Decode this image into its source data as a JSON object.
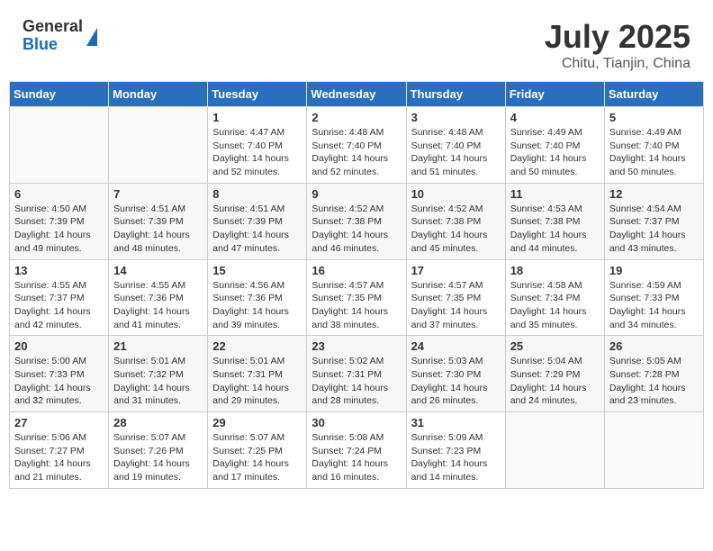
{
  "header": {
    "logo_general": "General",
    "logo_blue": "Blue",
    "main_title": "July 2025",
    "subtitle": "Chitu, Tianjin, China"
  },
  "weekdays": [
    "Sunday",
    "Monday",
    "Tuesday",
    "Wednesday",
    "Thursday",
    "Friday",
    "Saturday"
  ],
  "weeks": [
    [
      {
        "day": "",
        "info": ""
      },
      {
        "day": "",
        "info": ""
      },
      {
        "day": "1",
        "info": "Sunrise: 4:47 AM\nSunset: 7:40 PM\nDaylight: 14 hours\nand 52 minutes."
      },
      {
        "day": "2",
        "info": "Sunrise: 4:48 AM\nSunset: 7:40 PM\nDaylight: 14 hours\nand 52 minutes."
      },
      {
        "day": "3",
        "info": "Sunrise: 4:48 AM\nSunset: 7:40 PM\nDaylight: 14 hours\nand 51 minutes."
      },
      {
        "day": "4",
        "info": "Sunrise: 4:49 AM\nSunset: 7:40 PM\nDaylight: 14 hours\nand 50 minutes."
      },
      {
        "day": "5",
        "info": "Sunrise: 4:49 AM\nSunset: 7:40 PM\nDaylight: 14 hours\nand 50 minutes."
      }
    ],
    [
      {
        "day": "6",
        "info": "Sunrise: 4:50 AM\nSunset: 7:39 PM\nDaylight: 14 hours\nand 49 minutes."
      },
      {
        "day": "7",
        "info": "Sunrise: 4:51 AM\nSunset: 7:39 PM\nDaylight: 14 hours\nand 48 minutes."
      },
      {
        "day": "8",
        "info": "Sunrise: 4:51 AM\nSunset: 7:39 PM\nDaylight: 14 hours\nand 47 minutes."
      },
      {
        "day": "9",
        "info": "Sunrise: 4:52 AM\nSunset: 7:38 PM\nDaylight: 14 hours\nand 46 minutes."
      },
      {
        "day": "10",
        "info": "Sunrise: 4:52 AM\nSunset: 7:38 PM\nDaylight: 14 hours\nand 45 minutes."
      },
      {
        "day": "11",
        "info": "Sunrise: 4:53 AM\nSunset: 7:38 PM\nDaylight: 14 hours\nand 44 minutes."
      },
      {
        "day": "12",
        "info": "Sunrise: 4:54 AM\nSunset: 7:37 PM\nDaylight: 14 hours\nand 43 minutes."
      }
    ],
    [
      {
        "day": "13",
        "info": "Sunrise: 4:55 AM\nSunset: 7:37 PM\nDaylight: 14 hours\nand 42 minutes."
      },
      {
        "day": "14",
        "info": "Sunrise: 4:55 AM\nSunset: 7:36 PM\nDaylight: 14 hours\nand 41 minutes."
      },
      {
        "day": "15",
        "info": "Sunrise: 4:56 AM\nSunset: 7:36 PM\nDaylight: 14 hours\nand 39 minutes."
      },
      {
        "day": "16",
        "info": "Sunrise: 4:57 AM\nSunset: 7:35 PM\nDaylight: 14 hours\nand 38 minutes."
      },
      {
        "day": "17",
        "info": "Sunrise: 4:57 AM\nSunset: 7:35 PM\nDaylight: 14 hours\nand 37 minutes."
      },
      {
        "day": "18",
        "info": "Sunrise: 4:58 AM\nSunset: 7:34 PM\nDaylight: 14 hours\nand 35 minutes."
      },
      {
        "day": "19",
        "info": "Sunrise: 4:59 AM\nSunset: 7:33 PM\nDaylight: 14 hours\nand 34 minutes."
      }
    ],
    [
      {
        "day": "20",
        "info": "Sunrise: 5:00 AM\nSunset: 7:33 PM\nDaylight: 14 hours\nand 32 minutes."
      },
      {
        "day": "21",
        "info": "Sunrise: 5:01 AM\nSunset: 7:32 PM\nDaylight: 14 hours\nand 31 minutes."
      },
      {
        "day": "22",
        "info": "Sunrise: 5:01 AM\nSunset: 7:31 PM\nDaylight: 14 hours\nand 29 minutes."
      },
      {
        "day": "23",
        "info": "Sunrise: 5:02 AM\nSunset: 7:31 PM\nDaylight: 14 hours\nand 28 minutes."
      },
      {
        "day": "24",
        "info": "Sunrise: 5:03 AM\nSunset: 7:30 PM\nDaylight: 14 hours\nand 26 minutes."
      },
      {
        "day": "25",
        "info": "Sunrise: 5:04 AM\nSunset: 7:29 PM\nDaylight: 14 hours\nand 24 minutes."
      },
      {
        "day": "26",
        "info": "Sunrise: 5:05 AM\nSunset: 7:28 PM\nDaylight: 14 hours\nand 23 minutes."
      }
    ],
    [
      {
        "day": "27",
        "info": "Sunrise: 5:06 AM\nSunset: 7:27 PM\nDaylight: 14 hours\nand 21 minutes."
      },
      {
        "day": "28",
        "info": "Sunrise: 5:07 AM\nSunset: 7:26 PM\nDaylight: 14 hours\nand 19 minutes."
      },
      {
        "day": "29",
        "info": "Sunrise: 5:07 AM\nSunset: 7:25 PM\nDaylight: 14 hours\nand 17 minutes."
      },
      {
        "day": "30",
        "info": "Sunrise: 5:08 AM\nSunset: 7:24 PM\nDaylight: 14 hours\nand 16 minutes."
      },
      {
        "day": "31",
        "info": "Sunrise: 5:09 AM\nSunset: 7:23 PM\nDaylight: 14 hours\nand 14 minutes."
      },
      {
        "day": "",
        "info": ""
      },
      {
        "day": "",
        "info": ""
      }
    ]
  ]
}
